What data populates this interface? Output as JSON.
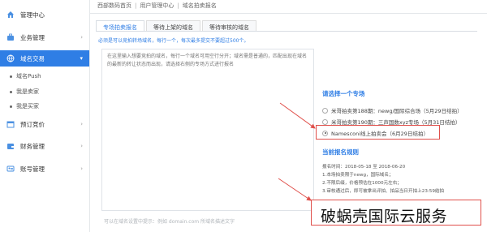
{
  "sidebar": {
    "items": [
      {
        "label": "管理中心",
        "icon": "home-icon"
      },
      {
        "label": "业务管理",
        "icon": "briefcase-icon"
      },
      {
        "label": "域名交易",
        "icon": "globe-icon"
      },
      {
        "label": "预订竞价",
        "icon": "calendar-icon"
      },
      {
        "label": "财务管理",
        "icon": "wallet-icon"
      },
      {
        "label": "账号管理",
        "icon": "user-card-icon"
      }
    ],
    "sub_items": [
      {
        "label": "域名Push"
      },
      {
        "label": "我是卖家"
      },
      {
        "label": "我是买家"
      }
    ]
  },
  "breadcrumb": [
    "西部数码首页",
    "用户管理中心",
    "域名拍卖报名"
  ],
  "tabs": [
    {
      "label": "专场拍卖报名"
    },
    {
      "label": "等待上架的域名"
    },
    {
      "label": "等待审核的域名"
    }
  ],
  "hint": "必须是可以竞拍转场域名，每行一个，每次最多提交不要超过500个。",
  "textarea": {
    "placeholder": "在这里输入想要竞拍的域名，每行一个域名可用空行分开；域名需是普通的，匹配出现在域名的最新的转让状态而出现，请选择右侧的专场方式进行报名"
  },
  "bottom_hint": "可以在域名设置中提示：例如 domain.com 所域名描述文字",
  "special": {
    "title": "请选择一个专场",
    "options": [
      {
        "label": "米哥拍卖第188期：newg/国际综合场（5月29日结拍）",
        "checked": false
      },
      {
        "label": "米哥拍卖第190期：三声国数xyz专场（5月31日结拍）",
        "checked": false
      },
      {
        "label": "Namesconi线上拍卖会（6月29日结拍）",
        "checked": true
      }
    ]
  },
  "rules": {
    "title": "当前报名规则",
    "lines": [
      "报名时间：2018-05-18 至 2018-06-20",
      "1.本场拍卖限于newg，国际域名；",
      "2.不限后缀，价格预估在1000元左右；",
      "3.审核通过后，即可被拿出评拍、拍品当日开拍上23:59结拍"
    ]
  },
  "watermark": "破蜗壳国际云服务",
  "colors": {
    "accent": "#2f7ee5",
    "highlight": "#e0504b"
  }
}
